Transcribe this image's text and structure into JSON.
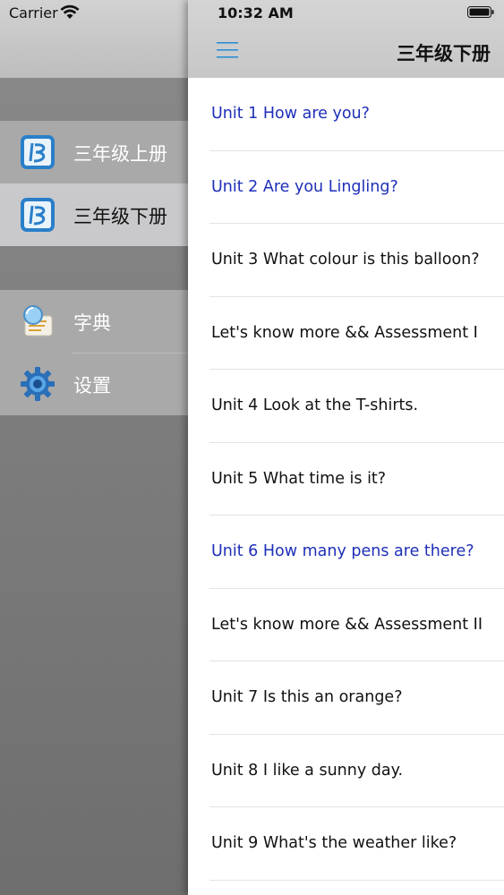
{
  "status": {
    "carrier": "Carrier",
    "time": "10:32 AM"
  },
  "nav": {
    "title": "三年级下册",
    "menu_icon": "hamburger-icon"
  },
  "drawer": {
    "items": [
      {
        "label": "三年级上册",
        "icon": "book-app-icon",
        "selected": false
      },
      {
        "label": "三年级下册",
        "icon": "book-app-icon",
        "selected": true
      },
      {
        "label": "字典",
        "icon": "dictionary-icon",
        "selected": false
      },
      {
        "label": "设置",
        "icon": "gear-icon",
        "selected": false
      }
    ]
  },
  "units": [
    {
      "title": "Unit 1 How are you?",
      "color": "blue"
    },
    {
      "title": "Unit 2 Are you Lingling?",
      "color": "blue"
    },
    {
      "title": "Unit 3 What colour is this balloon?",
      "color": "black"
    },
    {
      "title": "Let's know more && Assessment I",
      "color": "black"
    },
    {
      "title": "Unit 4 Look at the T-shirts.",
      "color": "black"
    },
    {
      "title": "Unit 5 What time is it?",
      "color": "black"
    },
    {
      "title": "Unit 6 How many pens are there?",
      "color": "blue"
    },
    {
      "title": "Let's know more && Assessment II",
      "color": "black"
    },
    {
      "title": "Unit 7 Is this an orange?",
      "color": "black"
    },
    {
      "title": "Unit 8 I like a sunny day.",
      "color": "black"
    },
    {
      "title": "Unit 9 What's the weather like?",
      "color": "black"
    }
  ],
  "colors": {
    "link_blue": "#1e2fb8",
    "accent": "#2a8fd6"
  }
}
